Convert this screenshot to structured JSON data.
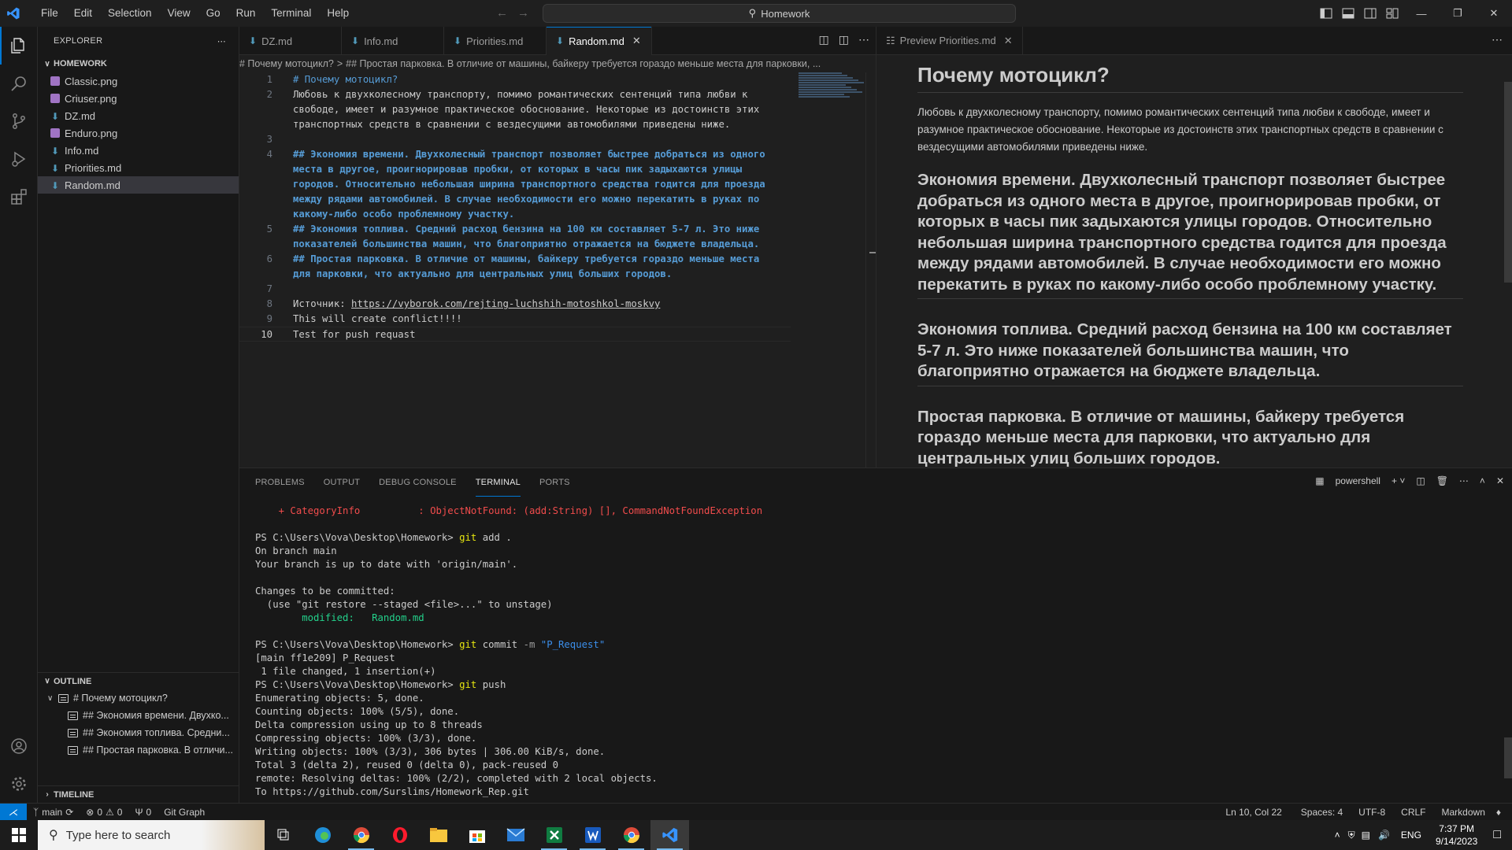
{
  "menu": [
    "File",
    "Edit",
    "Selection",
    "View",
    "Go",
    "Run",
    "Terminal",
    "Help"
  ],
  "command_center": "Homework",
  "explorer": {
    "title": "EXPLORER",
    "folder": "HOMEWORK",
    "files": [
      {
        "name": "Classic.png",
        "type": "png"
      },
      {
        "name": "Criuser.png",
        "type": "png"
      },
      {
        "name": "DZ.md",
        "type": "md"
      },
      {
        "name": "Enduro.png",
        "type": "png"
      },
      {
        "name": "Info.md",
        "type": "md"
      },
      {
        "name": "Priorities.md",
        "type": "md"
      },
      {
        "name": "Random.md",
        "type": "md",
        "selected": true
      }
    ],
    "outline_title": "OUTLINE",
    "outline": [
      "# Почему мотоцикл?",
      "## Экономия времени. Двухко...",
      "## Экономия топлива. Средни...",
      "## Простая парковка. В отличи..."
    ],
    "timeline_title": "TIMELINE"
  },
  "editor": {
    "tabs": [
      {
        "label": "DZ.md"
      },
      {
        "label": "Info.md"
      },
      {
        "label": "Priorities.md"
      },
      {
        "label": "Random.md",
        "active": true
      }
    ],
    "breadcrumb_1": "# Почему мотоцикл?",
    "breadcrumb_sep": ">",
    "breadcrumb_2": "## Простая парковка. В отличие от машины, байкеру требуется гораздо меньше места для парковки, ...",
    "lines": [
      {
        "n": "1",
        "parts": [
          {
            "t": "# Почему мотоцикл?",
            "c": "h"
          }
        ]
      },
      {
        "n": "2",
        "parts": [
          {
            "t": "Любовь к двухколесному транспорту, помимо романтических сентенций типа любви к",
            "c": ""
          }
        ]
      },
      {
        "n": "",
        "parts": [
          {
            "t": "свободе, имеет и разумное практическое обоснование. Некоторые из достоинств этих",
            "c": ""
          }
        ]
      },
      {
        "n": "",
        "parts": [
          {
            "t": "транспортных средств в сравнении с вездесущими автомобилями приведены ниже.",
            "c": ""
          }
        ]
      },
      {
        "n": "3",
        "parts": []
      },
      {
        "n": "4",
        "parts": [
          {
            "t": "## Экономия времени. Двухколесный транспорт позволяет быстрее добраться из одного",
            "c": "hb"
          }
        ]
      },
      {
        "n": "",
        "parts": [
          {
            "t": "места в другое, проигнорировав пробки, от которых в часы пик задыхаются улицы",
            "c": "hb"
          }
        ]
      },
      {
        "n": "",
        "parts": [
          {
            "t": "городов. Относительно небольшая ширина транспортного средства годится для проезда",
            "c": "hb"
          }
        ]
      },
      {
        "n": "",
        "parts": [
          {
            "t": "между рядами автомобилей. В случае необходимости его можно перекатить в руках по",
            "c": "hb"
          }
        ]
      },
      {
        "n": "",
        "parts": [
          {
            "t": "какому-либо особо проблемному участку.",
            "c": "hb"
          }
        ]
      },
      {
        "n": "5",
        "parts": [
          {
            "t": "## Экономия топлива. Средний расход бензина на 100 км составляет 5-7 л. Это ниже",
            "c": "hb"
          }
        ]
      },
      {
        "n": "",
        "parts": [
          {
            "t": "показателей большинства машин, что благоприятно отражается на бюджете владельца.",
            "c": "hb"
          }
        ]
      },
      {
        "n": "6",
        "parts": [
          {
            "t": "## Простая парковка. В отличие от машины, байкеру требуется гораздо меньше места",
            "c": "hb"
          }
        ]
      },
      {
        "n": "",
        "parts": [
          {
            "t": "для парковки, что актуально для центральных улиц больших городов.",
            "c": "hb"
          }
        ]
      },
      {
        "n": "7",
        "parts": []
      },
      {
        "n": "8",
        "parts": [
          {
            "t": "Источник: ",
            "c": ""
          },
          {
            "t": "https://vyborok.com/rejting-luchshih-motoshkol-moskvy",
            "c": "link"
          }
        ]
      },
      {
        "n": "9",
        "parts": [
          {
            "t": "This will create conflict!!!!",
            "c": ""
          }
        ]
      },
      {
        "n": "10",
        "parts": [
          {
            "t": "Test for push requast",
            "c": ""
          }
        ],
        "current": true
      }
    ]
  },
  "preview": {
    "tab": "Preview Priorities.md",
    "h1": "Почему мотоцикл?",
    "p": "Любовь к двухколесному транспорту, помимо романтических сентенций типа любви к свободе, имеет и разумное практическое обоснование. Некоторые из достоинств этих транспортных средств в сравнении с вездесущими автомобилями приведены ниже.",
    "h2": [
      "Экономия времени. Двухколесный транспорт позволяет быстрее добраться из одного места в другое, проигнорировав пробки, от которых в часы пик задыхаются улицы городов. Относительно небольшая ширина транспортного средства годится для проезда между рядами автомобилей. В случае необходимости его можно перекатить в руках по какому-либо особо проблемному участку.",
      "Экономия топлива. Средний расход бензина на 100 км составляет 5-7 л. Это ниже показателей большинства машин, что благоприятно отражается на бюджете владельца.",
      "Простая парковка. В отличие от машины, байкеру требуется гораздо меньше места для парковки, что актуально для центральных улиц больших городов."
    ]
  },
  "panel": {
    "tabs": [
      "PROBLEMS",
      "OUTPUT",
      "DEBUG CONSOLE",
      "TERMINAL",
      "PORTS"
    ],
    "active_tab": "TERMINAL",
    "shell": "powershell",
    "lines": [
      [
        {
          "t": "    + CategoryInfo          : ObjectNotFound: (add:String) [], CommandNotFoundException",
          "c": "red"
        }
      ],
      [],
      [
        {
          "t": "PS C:\\Users\\Vova\\Desktop\\Homework> ",
          "c": ""
        },
        {
          "t": "git",
          "c": "yel"
        },
        {
          "t": " add .",
          "c": ""
        }
      ],
      [
        {
          "t": "On branch main",
          "c": ""
        }
      ],
      [
        {
          "t": "Your branch is up to date with 'origin/main'.",
          "c": ""
        }
      ],
      [],
      [
        {
          "t": "Changes to be committed:",
          "c": ""
        }
      ],
      [
        {
          "t": "  (use \"git restore --staged <file>...\" to unstage)",
          "c": ""
        }
      ],
      [
        {
          "t": "        modified:   Random.md",
          "c": "grn"
        }
      ],
      [],
      [
        {
          "t": "PS C:\\Users\\Vova\\Desktop\\Homework> ",
          "c": ""
        },
        {
          "t": "git",
          "c": "yel"
        },
        {
          "t": " commit ",
          "c": ""
        },
        {
          "t": "-m",
          "c": "dim"
        },
        {
          "t": " \"P_Request\"",
          "c": "str"
        }
      ],
      [
        {
          "t": "[main ff1e209] P_Request",
          "c": ""
        }
      ],
      [
        {
          "t": " 1 file changed, 1 insertion(+)",
          "c": ""
        }
      ],
      [
        {
          "t": "PS C:\\Users\\Vova\\Desktop\\Homework> ",
          "c": ""
        },
        {
          "t": "git",
          "c": "yel"
        },
        {
          "t": " push",
          "c": ""
        }
      ],
      [
        {
          "t": "Enumerating objects: 5, done.",
          "c": ""
        }
      ],
      [
        {
          "t": "Counting objects: 100% (5/5), done.",
          "c": ""
        }
      ],
      [
        {
          "t": "Delta compression using up to 8 threads",
          "c": ""
        }
      ],
      [
        {
          "t": "Compressing objects: 100% (3/3), done.",
          "c": ""
        }
      ],
      [
        {
          "t": "Writing objects: 100% (3/3), 306 bytes | 306.00 KiB/s, done.",
          "c": ""
        }
      ],
      [
        {
          "t": "Total 3 (delta 2), reused 0 (delta 0), pack-reused 0",
          "c": ""
        }
      ],
      [
        {
          "t": "remote: Resolving deltas: 100% (2/2), completed with 2 local objects.",
          "c": ""
        }
      ],
      [
        {
          "t": "To https://github.com/Surslims/Homework_Rep.git",
          "c": ""
        }
      ]
    ]
  },
  "status": {
    "branch": "main",
    "errors": "0",
    "warnings": "0",
    "ports": "0",
    "git_graph": "Git Graph",
    "position": "Ln 10, Col 22",
    "spaces": "Spaces: 4",
    "encoding": "UTF-8",
    "eol": "CRLF",
    "language": "Markdown"
  },
  "taskbar": {
    "search_placeholder": "Type here to search",
    "lang": "ENG",
    "time": "7:37 PM",
    "date": "9/14/2023"
  },
  "colors": {
    "accent": "#0078d4",
    "heading": "#569cd6",
    "terminal_red": "#f14c4c",
    "terminal_green": "#23d18b",
    "git_yellow": "#e5e510"
  }
}
